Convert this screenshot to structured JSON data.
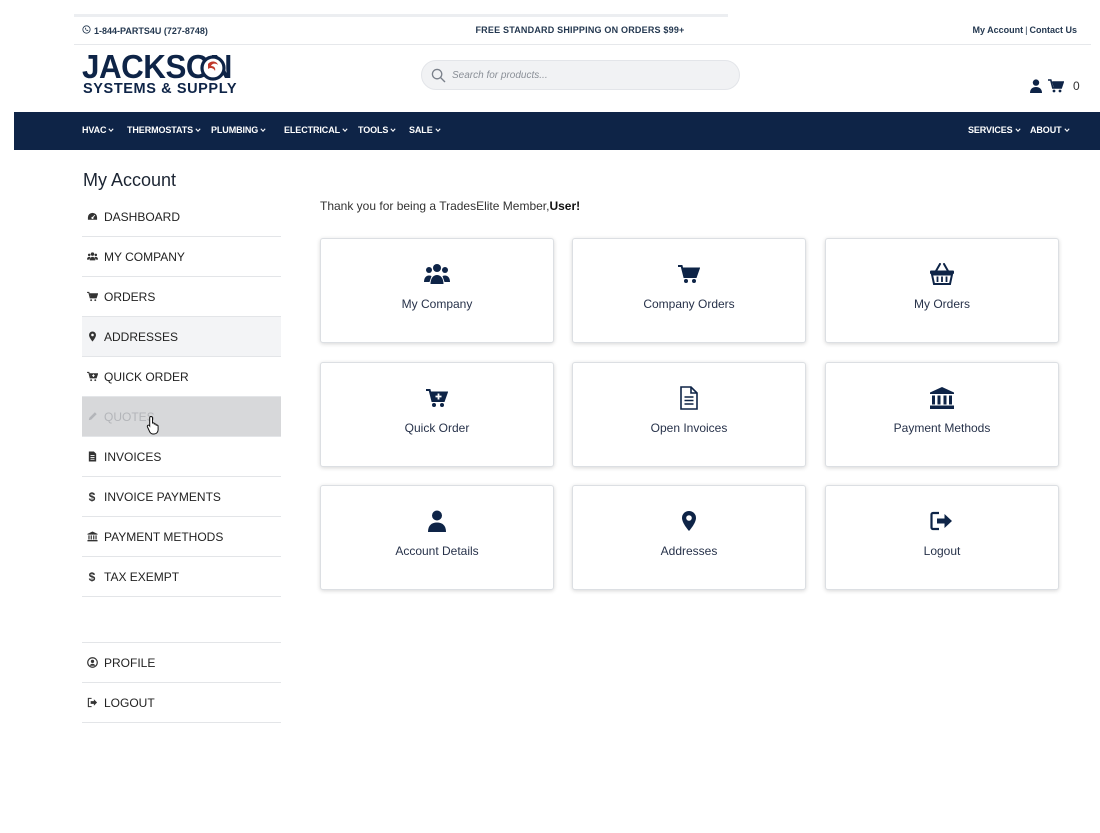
{
  "topbar": {
    "phone": "1-844-PARTS4U (727-8748)",
    "shipping": "FREE STANDARD SHIPPING ON ORDERS $99+",
    "my_account": "My Account",
    "separator": "|",
    "contact_us": "Contact Us"
  },
  "header": {
    "logo_top": "JACKSON",
    "logo_bottom": "SYSTEMS & SUPPLY",
    "search_placeholder": "Search for products...",
    "cart_count": "0"
  },
  "nav": {
    "left": [
      "HVAC",
      "THERMOSTATS",
      "PLUMBING",
      "ELECTRICAL",
      "TOOLS",
      "SALE"
    ],
    "right": [
      "SERVICES",
      "ABOUT"
    ]
  },
  "sidebar": {
    "title": "My Account",
    "items": [
      {
        "label": "DASHBOARD",
        "icon": "dashboard-icon"
      },
      {
        "label": "MY COMPANY",
        "icon": "users-icon"
      },
      {
        "label": "ORDERS",
        "icon": "cart-icon"
      },
      {
        "label": "ADDRESSES",
        "icon": "map-marker-icon"
      },
      {
        "label": "QUICK ORDER",
        "icon": "cart-plus-icon"
      },
      {
        "label": "QUOTES",
        "icon": "pencil-icon"
      },
      {
        "label": "INVOICES",
        "icon": "invoice-icon"
      },
      {
        "label": "INVOICE PAYMENTS",
        "icon": "dollar-icon"
      },
      {
        "label": "PAYMENT METHODS",
        "icon": "bank-icon"
      },
      {
        "label": "TAX EXEMPT",
        "icon": "dollar-icon"
      }
    ],
    "bottom_items": [
      {
        "label": "PROFILE",
        "icon": "user-circle-icon"
      },
      {
        "label": "LOGOUT",
        "icon": "sign-out-icon"
      }
    ]
  },
  "main": {
    "welcome_prefix": "Thank you for being a TradesElite Member,",
    "welcome_name": "User!",
    "cards": [
      {
        "label": "My Company",
        "icon": "users-icon"
      },
      {
        "label": "Company Orders",
        "icon": "cart-icon"
      },
      {
        "label": "My Orders",
        "icon": "basket-icon"
      },
      {
        "label": "Quick Order",
        "icon": "cart-plus-icon"
      },
      {
        "label": "Open Invoices",
        "icon": "document-icon"
      },
      {
        "label": "Payment Methods",
        "icon": "bank-icon"
      },
      {
        "label": "Account Details",
        "icon": "user-icon"
      },
      {
        "label": "Addresses",
        "icon": "map-marker-icon"
      },
      {
        "label": "Logout",
        "icon": "sign-out-icon"
      }
    ]
  },
  "colors": {
    "navy": "#0e2447",
    "swirl_red": "#c0392b",
    "sidebar_active": "#d7d8da"
  }
}
